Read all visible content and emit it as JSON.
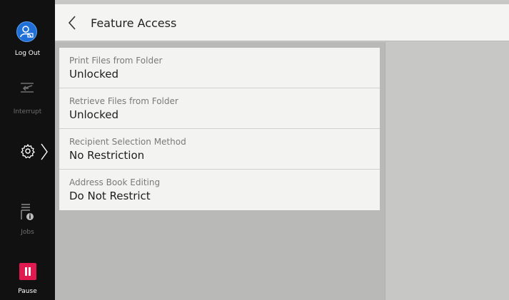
{
  "sidebar": {
    "logout_label": "Log Out",
    "interrupt_label": "Interrupt",
    "jobs_label": "Jobs",
    "pause_label": "Pause"
  },
  "header": {
    "title": "Feature Access"
  },
  "rows": [
    {
      "label": "Print Files from Folder",
      "value": "Unlocked"
    },
    {
      "label": "Retrieve Files from Folder",
      "value": "Unlocked"
    },
    {
      "label": "Recipient Selection Method",
      "value": "No Restriction"
    },
    {
      "label": "Address Book Editing",
      "value": "Do Not Restrict"
    }
  ],
  "colors": {
    "accent_blue": "#1f6fd6",
    "pause_red": "#e01a4f"
  }
}
